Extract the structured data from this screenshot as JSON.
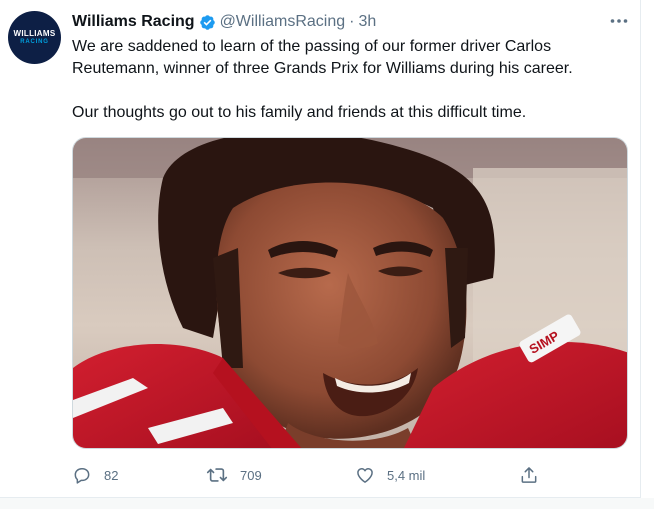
{
  "tweet": {
    "account_name": "Williams Racing",
    "handle": "@WilliamsRacing",
    "separator": "·",
    "time": "3h",
    "avatar": {
      "line1": "WILLIAMS",
      "line2": "RACING"
    },
    "text_paragraphs": [
      "We are saddened to learn of the passing of our former driver Carlos Reutemann, winner of three Grands Prix for Williams during his career.",
      "Our thoughts go out to his family and friends at this difficult time."
    ],
    "media": {
      "kind": "photo",
      "badge_text": "SIMP"
    },
    "actions": {
      "reply": {
        "icon": "reply-icon",
        "count": "82"
      },
      "retweet": {
        "icon": "retweet-icon",
        "count": "709"
      },
      "like": {
        "icon": "heart-icon",
        "count": "5,4 mil"
      },
      "share": {
        "icon": "share-icon"
      }
    }
  },
  "colors": {
    "text": "#0f1419",
    "secondary": "#5b7083",
    "verified": "#1d9bf0",
    "avatar_bg": "#0d1f45",
    "avatar_accent": "#00a0de",
    "suit_red": "#c3162a"
  }
}
